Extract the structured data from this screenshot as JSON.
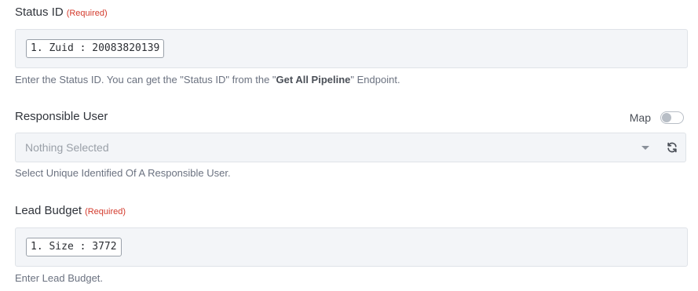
{
  "status_id": {
    "label": "Status ID",
    "required": "(Required)",
    "chip_value": "1. Zuid : 20083820139",
    "help_prefix": "Enter the Status ID. You can get the \"Status ID\" from the \"",
    "help_bold": "Get All Pipeline",
    "help_suffix": "\" Endpoint."
  },
  "responsible_user": {
    "label": "Responsible User",
    "map_label": "Map",
    "map_toggle_on": false,
    "selected": "Nothing Selected",
    "help": "Select Unique Identified Of A Responsible User.",
    "refresh_icon": "refresh-icon"
  },
  "lead_budget": {
    "label": "Lead Budget",
    "required": "(Required)",
    "chip_value": "1. Size : 3772",
    "help": "Enter Lead Budget."
  },
  "colors": {
    "required": "#d33a2c",
    "field_bg": "#f3f5f8",
    "border": "#dfe3e8"
  }
}
